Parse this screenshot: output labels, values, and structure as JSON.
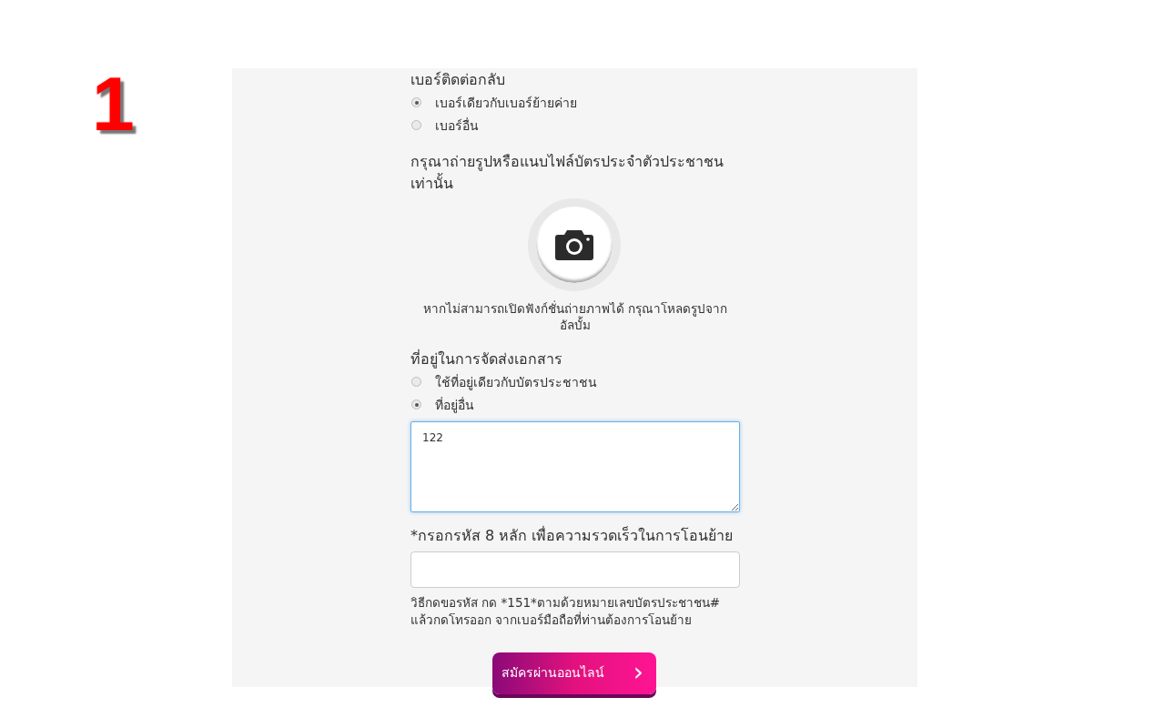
{
  "step_number": "1",
  "sections": [
    {
      "kind": "radio",
      "label": "เบอร์ติดต่อกลับ",
      "options": [
        {
          "label": "เบอร์เดียวกับเบอร์ย้ายค่าย",
          "selected": true
        },
        {
          "label": "เบอร์อื่น",
          "selected": false
        }
      ]
    },
    {
      "kind": "upload",
      "label": "กรุณาถ่ายรูปหรือแนบไฟล์บัตรประจำตัวประชาชนเท่านั้น",
      "note": "หากไม่สามารถเปิดฟังก์ชั่นถ่ายภาพได้ กรุณาโหลดรูปจากอัลบั้ม"
    },
    {
      "kind": "radio",
      "label": "ที่อยู่ในการจัดส่งเอกสาร",
      "options": [
        {
          "label": "ใช้ที่อยู่เดียวกับบัตรประชาชน",
          "selected": false
        },
        {
          "label": "ที่อยู่อื่น",
          "selected": true
        }
      ]
    },
    {
      "kind": "textarea",
      "value": "122"
    },
    {
      "kind": "input",
      "label": "*กรอกรหัส 8 หลัก เพื่อความรวดเร็วในการโอนย้าย",
      "help": "วิธีกดขอรหัส กด *151*ตามด้วยหมายเลขบัตรประชาชน# แล้วกดโทรออก จากเบอร์มือถือที่ท่านต้องการโอนย้าย"
    }
  ],
  "submit_button": {
    "label": "สมัครผ่านออนไลน์",
    "icon": "›"
  }
}
